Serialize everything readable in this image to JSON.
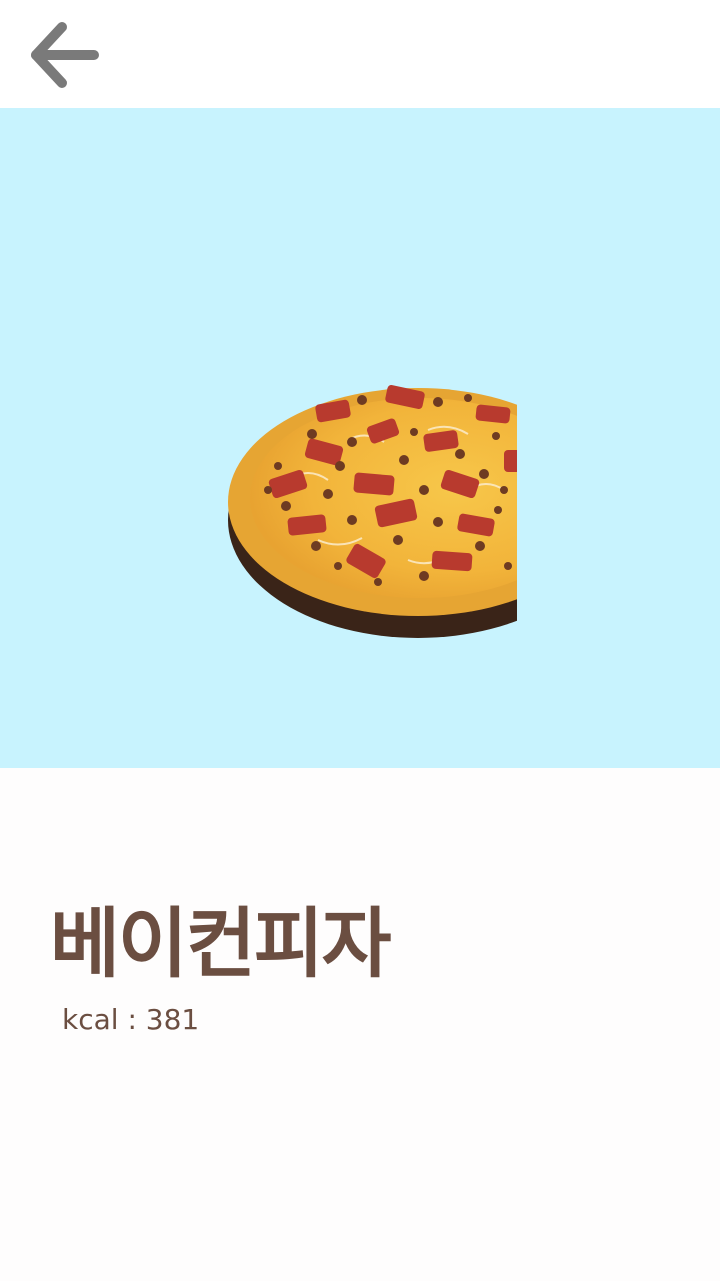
{
  "header": {
    "back_icon": "arrow-left-icon",
    "back_icon_color": "#7a7a7a"
  },
  "hero": {
    "background_color": "#c8f3fe",
    "image": "bacon-pizza-image"
  },
  "food": {
    "name": "베이컨피자",
    "calories": "kcal : 381",
    "text_color": "#6b4e41"
  }
}
